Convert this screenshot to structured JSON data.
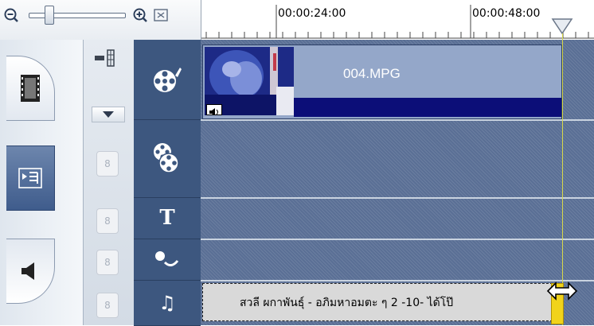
{
  "toolbar": {
    "zoom_out_icon": "zoom-out-icon",
    "zoom_in_icon": "zoom-in-icon",
    "fit_icon": "fit-to-window-icon"
  },
  "ruler": {
    "time_labels": [
      "00:00:24:00",
      "00:00:48:00"
    ]
  },
  "mode_tabs": [
    {
      "name": "video",
      "icon": "film-icon"
    },
    {
      "name": "overlay",
      "icon": "overlay-icon",
      "active": true
    },
    {
      "name": "audio",
      "icon": "speaker-icon"
    }
  ],
  "tracks": [
    {
      "type": "video",
      "icon": "video-reel-icon"
    },
    {
      "type": "overlay",
      "icon": "overlay-reels-icon"
    },
    {
      "type": "title",
      "icon": "title-T-icon",
      "glyph": "T"
    },
    {
      "type": "voice",
      "icon": "voice-icon"
    },
    {
      "type": "music",
      "icon": "music-note-icon",
      "glyph": "♫"
    }
  ],
  "clips": {
    "video": {
      "name": "004.MPG"
    },
    "music": {
      "title": "สวลี ผกาพันธุ์ - อภิมหาอมตะ ๆ 2 -10- ได้โป๊"
    }
  },
  "colors": {
    "track_bg": "#5a6f95",
    "icon_column": "#3d577f",
    "video_clip": "#94a7c9",
    "clip_bar": "#0c0e78",
    "playhead": "#d8d84a",
    "marker": "#f1d31b"
  }
}
